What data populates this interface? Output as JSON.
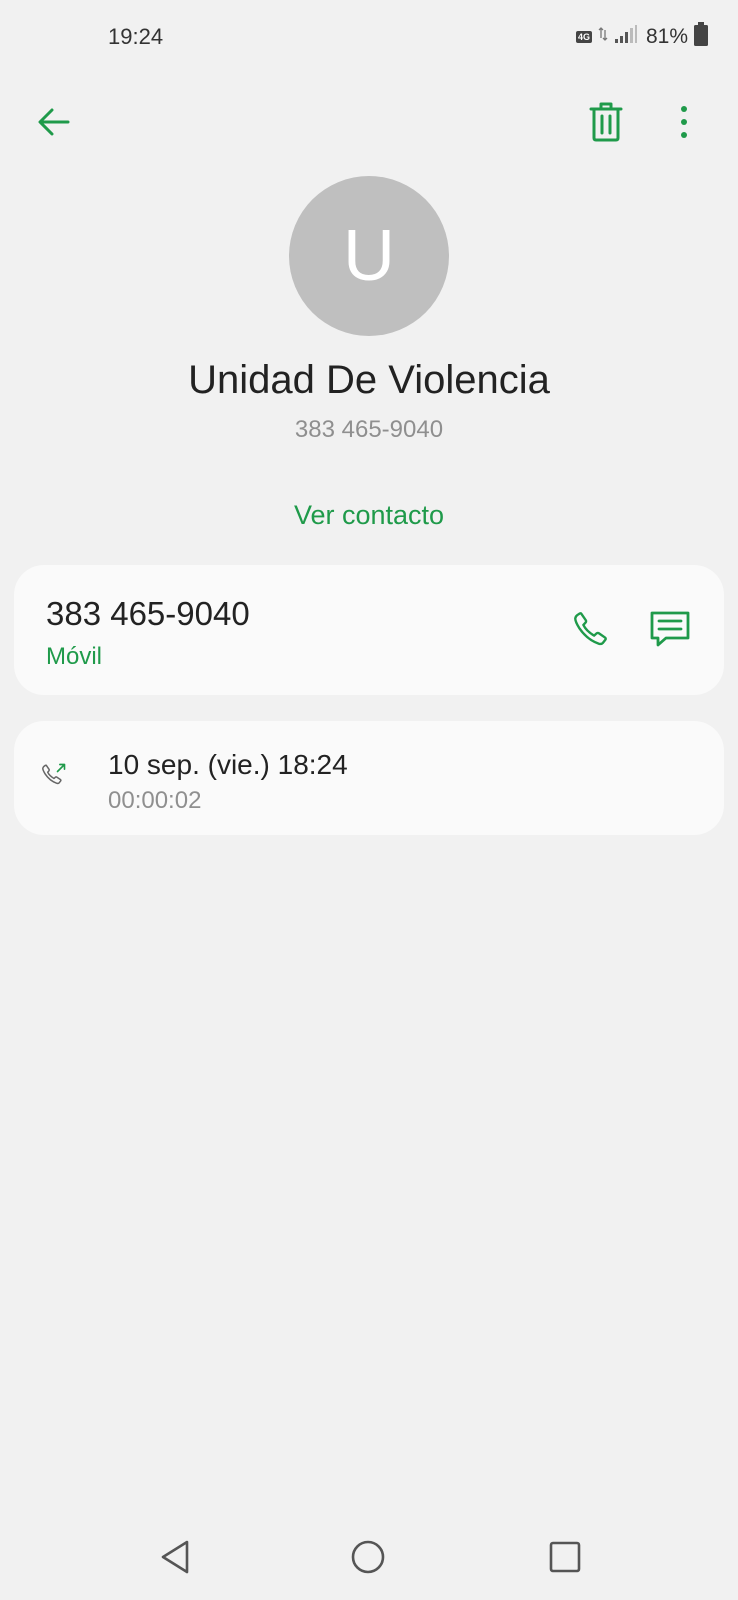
{
  "status_bar": {
    "time": "19:24",
    "network": "4G",
    "battery": "81%"
  },
  "contact": {
    "initial": "U",
    "name": "Unidad De Violencia",
    "number": "383 465-9040",
    "view_contact_label": "Ver contacto"
  },
  "number_card": {
    "number": "383 465-9040",
    "type": "Móvil"
  },
  "call_log": [
    {
      "date": "10 sep. (vie.) 18:24",
      "duration": "00:00:02"
    }
  ],
  "icons": {
    "back": "arrow-left-icon",
    "delete": "trash-icon",
    "more": "more-vertical-icon",
    "call": "phone-icon",
    "message": "message-icon",
    "outgoing_call": "outgoing-call-icon"
  },
  "colors": {
    "accent": "#1f9a4a",
    "background": "#f1f1f1",
    "card": "#fafafa",
    "avatar": "#bfbfbf"
  }
}
